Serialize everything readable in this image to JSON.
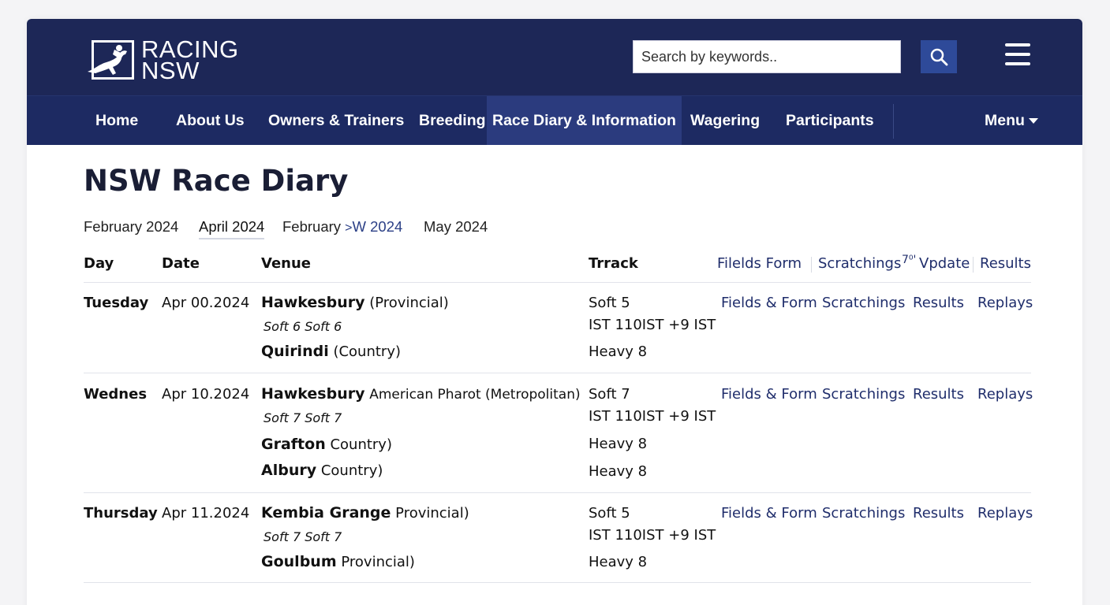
{
  "brand": {
    "line1": "RACING",
    "line2": "NSW"
  },
  "search": {
    "placeholder": "Search by keywords.."
  },
  "nav": {
    "items": [
      "Home",
      "About Us",
      "Owners & Trainers",
      "Breeding",
      "Race Diary & Information",
      "Wagering",
      "Participants"
    ],
    "menu_label": "Menu",
    "active_index": 4
  },
  "page_title": "NSW Race Diary",
  "month_tabs": {
    "t0": "February 2024",
    "t1": "April 2024",
    "t2_prefix": "February",
    "t2_chev": ">",
    "t2_suffix": "W 2024",
    "t3": "May 2024"
  },
  "table_header": {
    "day": "Day",
    "date": "Date",
    "venue": "Venue",
    "track": "Trrack",
    "fields_form": "Filelds Form",
    "scratchings": "Scratchings",
    "update_prefix": "7⁰'",
    "update": "Vpdate",
    "results": "Results"
  },
  "rows": [
    {
      "day": "Tuesday",
      "date": "Apr 00.2024",
      "venues": [
        {
          "name": "Hawkesbury",
          "type": "(Provincial)",
          "track": "Soft 5",
          "condition": "Soft 6 Soft 6",
          "track_detail": "IST 110IST +9 IST"
        },
        {
          "name": "Quirindi",
          "type": "(Country)",
          "track": "Heavy 8"
        }
      ],
      "links": {
        "fields": "Fields & Form",
        "scratchings": "Scratchings",
        "results": "Results",
        "replays": "Replays"
      }
    },
    {
      "day": "Wednes",
      "date": "Apr 10.2024",
      "venues": [
        {
          "name": "Hawkesbury",
          "type": "American Pharot (Metropolitan)",
          "track": "Soft 7",
          "condition": "Soft 7 Soft 7",
          "track_detail": "IST 110IST +9 IST"
        },
        {
          "name": "Grafton",
          "type": "Country)",
          "track": "Heavy 8"
        },
        {
          "name": "Albury",
          "type": "Country)",
          "track": "Heavy 8"
        }
      ],
      "links": {
        "fields": "Fields & Form",
        "scratchings": "Scratchings",
        "results": "Results",
        "replays": "Replays"
      }
    },
    {
      "day": "Thursday",
      "date": "Apr 11.2024",
      "venues": [
        {
          "name": "Kembia Grange",
          "type": "Provincial)",
          "track": "Soft 5",
          "condition": "Soft 7 Soft 7",
          "track_detail": "IST 110IST +9 IST"
        },
        {
          "name": "Goulbum",
          "type": "Provincial)",
          "track": "Heavy 8"
        }
      ],
      "links": {
        "fields": "Fields & Form",
        "scratchings": "Scratchings",
        "results": "Results",
        "replays": "Replays"
      }
    }
  ],
  "colors": {
    "header_bg": "#1d2757",
    "nav_bg": "#1d2a62",
    "nav_active": "#2b3b7e",
    "search_btn": "#2e4a99",
    "link": "#1f2d6b"
  },
  "icons": {
    "logo": "horse-and-jockey-logo-icon",
    "search": "search-icon",
    "menu": "hamburger-menu-icon",
    "caret": "caret-down-icon"
  }
}
